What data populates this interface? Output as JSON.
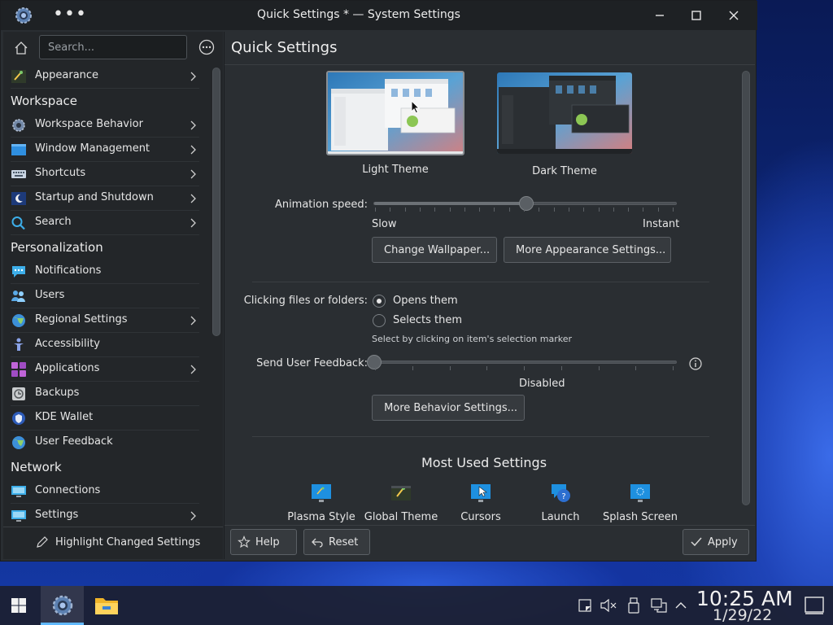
{
  "window": {
    "title": "Quick Settings * — System Settings"
  },
  "sidebar": {
    "search_placeholder": "Search...",
    "appearance": "Appearance",
    "categories": {
      "workspace": "Workspace",
      "personalization": "Personalization",
      "network": "Network"
    },
    "items": [
      {
        "label": "Workspace Behavior"
      },
      {
        "label": "Window Management"
      },
      {
        "label": "Shortcuts"
      },
      {
        "label": "Startup and Shutdown"
      },
      {
        "label": "Search"
      },
      {
        "label": "Notifications"
      },
      {
        "label": "Users"
      },
      {
        "label": "Regional Settings"
      },
      {
        "label": "Accessibility"
      },
      {
        "label": "Applications"
      },
      {
        "label": "Backups"
      },
      {
        "label": "KDE Wallet"
      },
      {
        "label": "User Feedback"
      },
      {
        "label": "Connections"
      },
      {
        "label": "Settings"
      }
    ],
    "footer_label": "Highlight Changed Settings"
  },
  "content": {
    "page_title": "Quick Settings",
    "themes": {
      "light": "Light Theme",
      "dark": "Dark Theme",
      "selected": "light"
    },
    "animation": {
      "label": "Animation speed:",
      "min_label": "Slow",
      "max_label": "Instant",
      "value_fraction": 0.5
    },
    "buttons": {
      "change_wallpaper": "Change Wallpaper...",
      "more_appearance": "More Appearance Settings...",
      "more_behavior": "More Behavior Settings..."
    },
    "clicking": {
      "label": "Clicking files or folders:",
      "opens": "Opens them",
      "selects": "Selects them",
      "hint": "Select by clicking on item's selection marker",
      "selected": "opens"
    },
    "feedback": {
      "label": "Send User Feedback:",
      "value_label": "Disabled",
      "value_fraction": 0
    },
    "most_used": {
      "title": "Most Used Settings",
      "items": [
        {
          "label": "Plasma Style"
        },
        {
          "label": "Global Theme"
        },
        {
          "label": "Cursors"
        },
        {
          "label": "Launch"
        },
        {
          "label": "Splash Screen"
        }
      ]
    },
    "footer": {
      "help": "Help",
      "reset": "Reset",
      "apply": "Apply"
    }
  },
  "taskbar": {
    "time": "10:25 AM",
    "date": "1/29/22"
  },
  "colors": {
    "window_bg": "#2a2e32",
    "sidebar_bg": "#232629",
    "titlebar_bg": "#1e2124",
    "accent": "#3daee9"
  }
}
